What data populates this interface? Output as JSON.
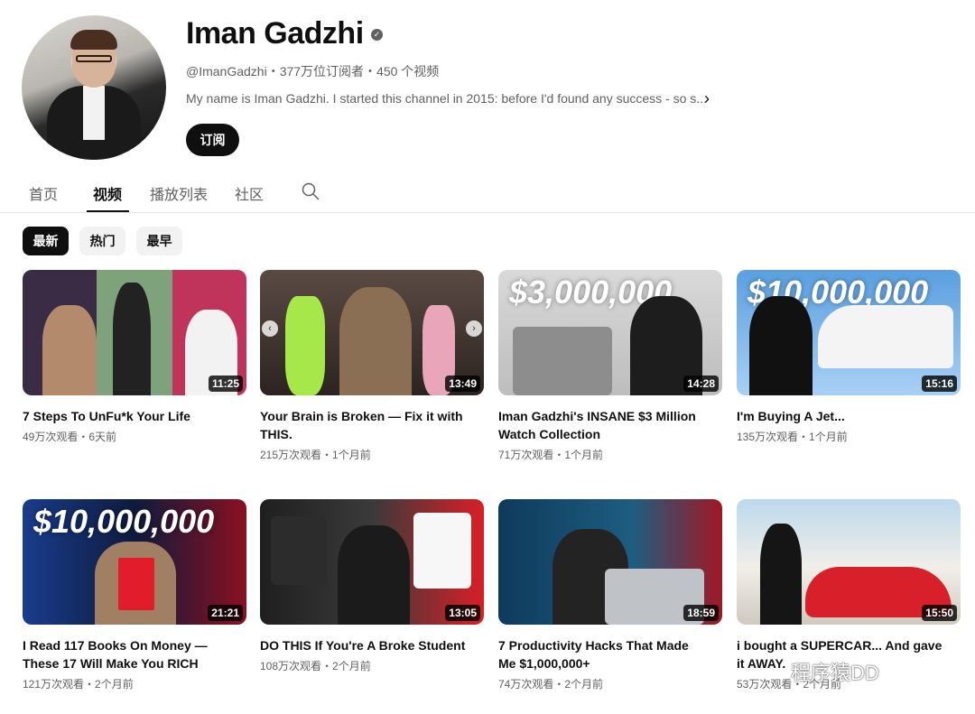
{
  "channel": {
    "name": "Iman Gadzhi",
    "handle_meta": "@ImanGadzhi・377万位订阅者・450 个视频",
    "description": "My name is Iman Gadzhi. I started this channel in 2015: before I'd found any success - so s...",
    "subscribe_label": "订阅"
  },
  "tabs": [
    {
      "label": "首页"
    },
    {
      "label": "视频"
    },
    {
      "label": "播放列表"
    },
    {
      "label": "社区"
    }
  ],
  "chips": [
    {
      "label": "最新"
    },
    {
      "label": "热门"
    },
    {
      "label": "最早"
    }
  ],
  "videos": [
    {
      "title": "7 Steps To UnFu*k Your Life",
      "meta": "49万次观看・6天前",
      "duration": "11:25"
    },
    {
      "title": "Your Brain is Broken — Fix it with THIS.",
      "meta": "215万次观看・1个月前",
      "duration": "13:49"
    },
    {
      "title": "Iman Gadzhi's INSANE $3 Million Watch Collection",
      "meta": "71万次观看・1个月前",
      "duration": "14:28",
      "thumb_text": "$3,000,000"
    },
    {
      "title": "I'm Buying A Jet...",
      "meta": "135万次观看・1个月前",
      "duration": "15:16",
      "thumb_text": "$10,000,000"
    },
    {
      "title": "I Read 117 Books On Money — These 17 Will Make You RICH",
      "meta": "121万次观看・2个月前",
      "duration": "21:21",
      "thumb_text": "$10,000,000"
    },
    {
      "title": "DO THIS If You're A Broke Student",
      "meta": "108万次观看・2个月前",
      "duration": "13:05"
    },
    {
      "title": "7 Productivity Hacks That Made Me $1,000,000+",
      "meta": "74万次观看・2个月前",
      "duration": "18:59"
    },
    {
      "title": "i bought a SUPERCAR... And gave it AWAY.",
      "meta": "53万次观看・2个月前",
      "duration": "15:50"
    }
  ],
  "watermark": "程序猿DD",
  "colors": {
    "accent": "#0f0f0f",
    "secondary_text": "#606060",
    "chip_bg": "#f2f2f2"
  }
}
